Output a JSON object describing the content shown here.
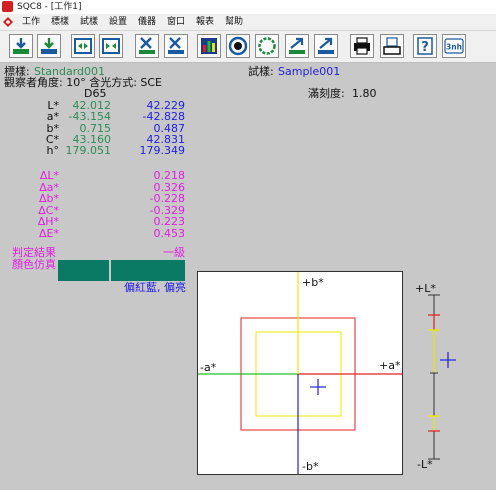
{
  "window": {
    "title": "SQC8 - [工作1]"
  },
  "menu": {
    "items": [
      "工作",
      "標樣",
      "試樣",
      "設置",
      "儀器",
      "窗口",
      "報表",
      "幫助"
    ]
  },
  "toolbar": {
    "buttons": [
      "download-icon",
      "download-alt-icon",
      "compare-icon",
      "compare-alt-icon",
      "delete-icon",
      "delete-alt-icon",
      "chart-icon",
      "target-icon",
      "circle-icon",
      "export-icon",
      "export-alt-icon",
      "print-icon",
      "print-preview-icon",
      "help-icon",
      "3nh-logo-icon"
    ],
    "logo_text": "3nh",
    "help_text": "?"
  },
  "header": {
    "standard_label": "標樣:",
    "standard_value": "Standard001",
    "sample_label": "試樣:",
    "sample_value": "Sample001",
    "observer": "觀察者角度: 10°  含光方式: SCE",
    "tolerance_label": "滿刻度:",
    "tolerance_value": "1.80",
    "illuminant": "D65"
  },
  "measurements": [
    {
      "label": "L*",
      "standard": "42.012",
      "sample": "42.229"
    },
    {
      "label": "a*",
      "standard": "-43.154",
      "sample": "-42.828"
    },
    {
      "label": "b*",
      "standard": "0.715",
      "sample": "0.487"
    },
    {
      "label": "C*",
      "standard": "43.160",
      "sample": "42.831"
    },
    {
      "label": "h°",
      "standard": "179.051",
      "sample": "179.349"
    }
  ],
  "deltas": [
    {
      "label": "ΔL*",
      "value": "0.218"
    },
    {
      "label": "Δa*",
      "value": "0.326"
    },
    {
      "label": "Δb*",
      "value": "-0.228"
    },
    {
      "label": "ΔC*",
      "value": "-0.329"
    },
    {
      "label": "ΔH*",
      "value": "0.223"
    },
    {
      "label": "ΔE*",
      "value": "0.453"
    }
  ],
  "result": {
    "judgement_label": "判定結果",
    "judgement_value": "一級",
    "color_sim_label": "顏色仿真",
    "description": "偏紅藍, 偏亮"
  },
  "diagram": {
    "plus_b": "+b*",
    "minus_b": "-b*",
    "plus_a": "+a*",
    "minus_a": "-a*",
    "plus_l": "+L*",
    "minus_l": "-L*"
  },
  "colors": {
    "standard": "#2e8b57",
    "sample": "#2020e0",
    "delta": "#e020e0",
    "swatch": "#0b7a64",
    "tolerance_outer": "#e02020",
    "tolerance_inner": "#e8e800"
  }
}
